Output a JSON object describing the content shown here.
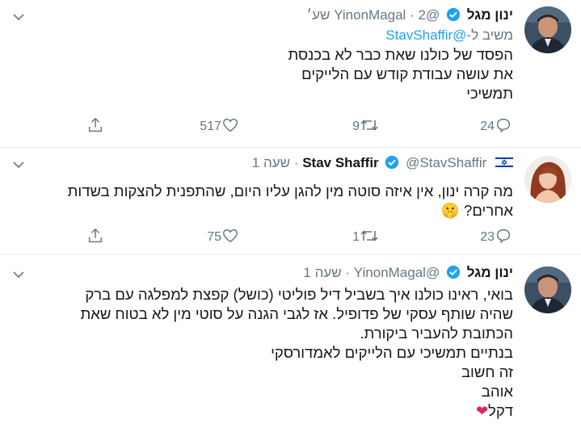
{
  "tweets": [
    {
      "name": "ינון מגל",
      "handle": "@YinonMagal",
      "sep": "·",
      "time": "2 שע׳",
      "reply_label": "משיב ל-",
      "reply_mention": "@StavShaffir",
      "lines": [
        "הפסד של כולנו שאת כבר לא בכנסת",
        "את עושה עבודת קודש עם הלייקים",
        "תמשיכי"
      ],
      "replies": "24",
      "retweets": "9",
      "likes": "517"
    },
    {
      "name": "Stav Shaffir",
      "handle": "@StavShaffir",
      "sep": "·",
      "time": "שעה 1",
      "lines": [
        "מה קרה ינון, אין איזה סוטה מין להגן עליו היום, שהתפנית להצקות בשדות",
        "אחרים? 🤫"
      ],
      "replies": "23",
      "retweets": "1",
      "likes": "75"
    },
    {
      "name": "ינון מגל",
      "handle": "@YinonMagal",
      "sep": "·",
      "time": "שעה 1",
      "lines": [
        "בואי, ראינו כולנו איך בשביל דיל פוליטי (כושל) קפצת למפלגה עם ברק",
        "שהיה שותף עסקי של פדופיל. אז לגבי הגנה על סוטי מין לא בטוח שאת",
        "הכתובת להעביר ביקורת.",
        "בנתיים תמשיכי עם הלייקים לאמדורסקי",
        "זה חשוב",
        "אוהב",
        "דקל"
      ]
    }
  ],
  "icons": {
    "reply": "reply-icon",
    "retweet": "retweet-icon",
    "like": "like-icon",
    "share": "share-icon",
    "verified": "verified-badge-icon",
    "flag": "israel-flag-icon",
    "more": "chevron-down-icon"
  },
  "colors": {
    "accent": "#1da1f2",
    "text": "#14171a",
    "muted": "#657786",
    "divider": "#e6ecf0",
    "heart": "#e0245e"
  }
}
